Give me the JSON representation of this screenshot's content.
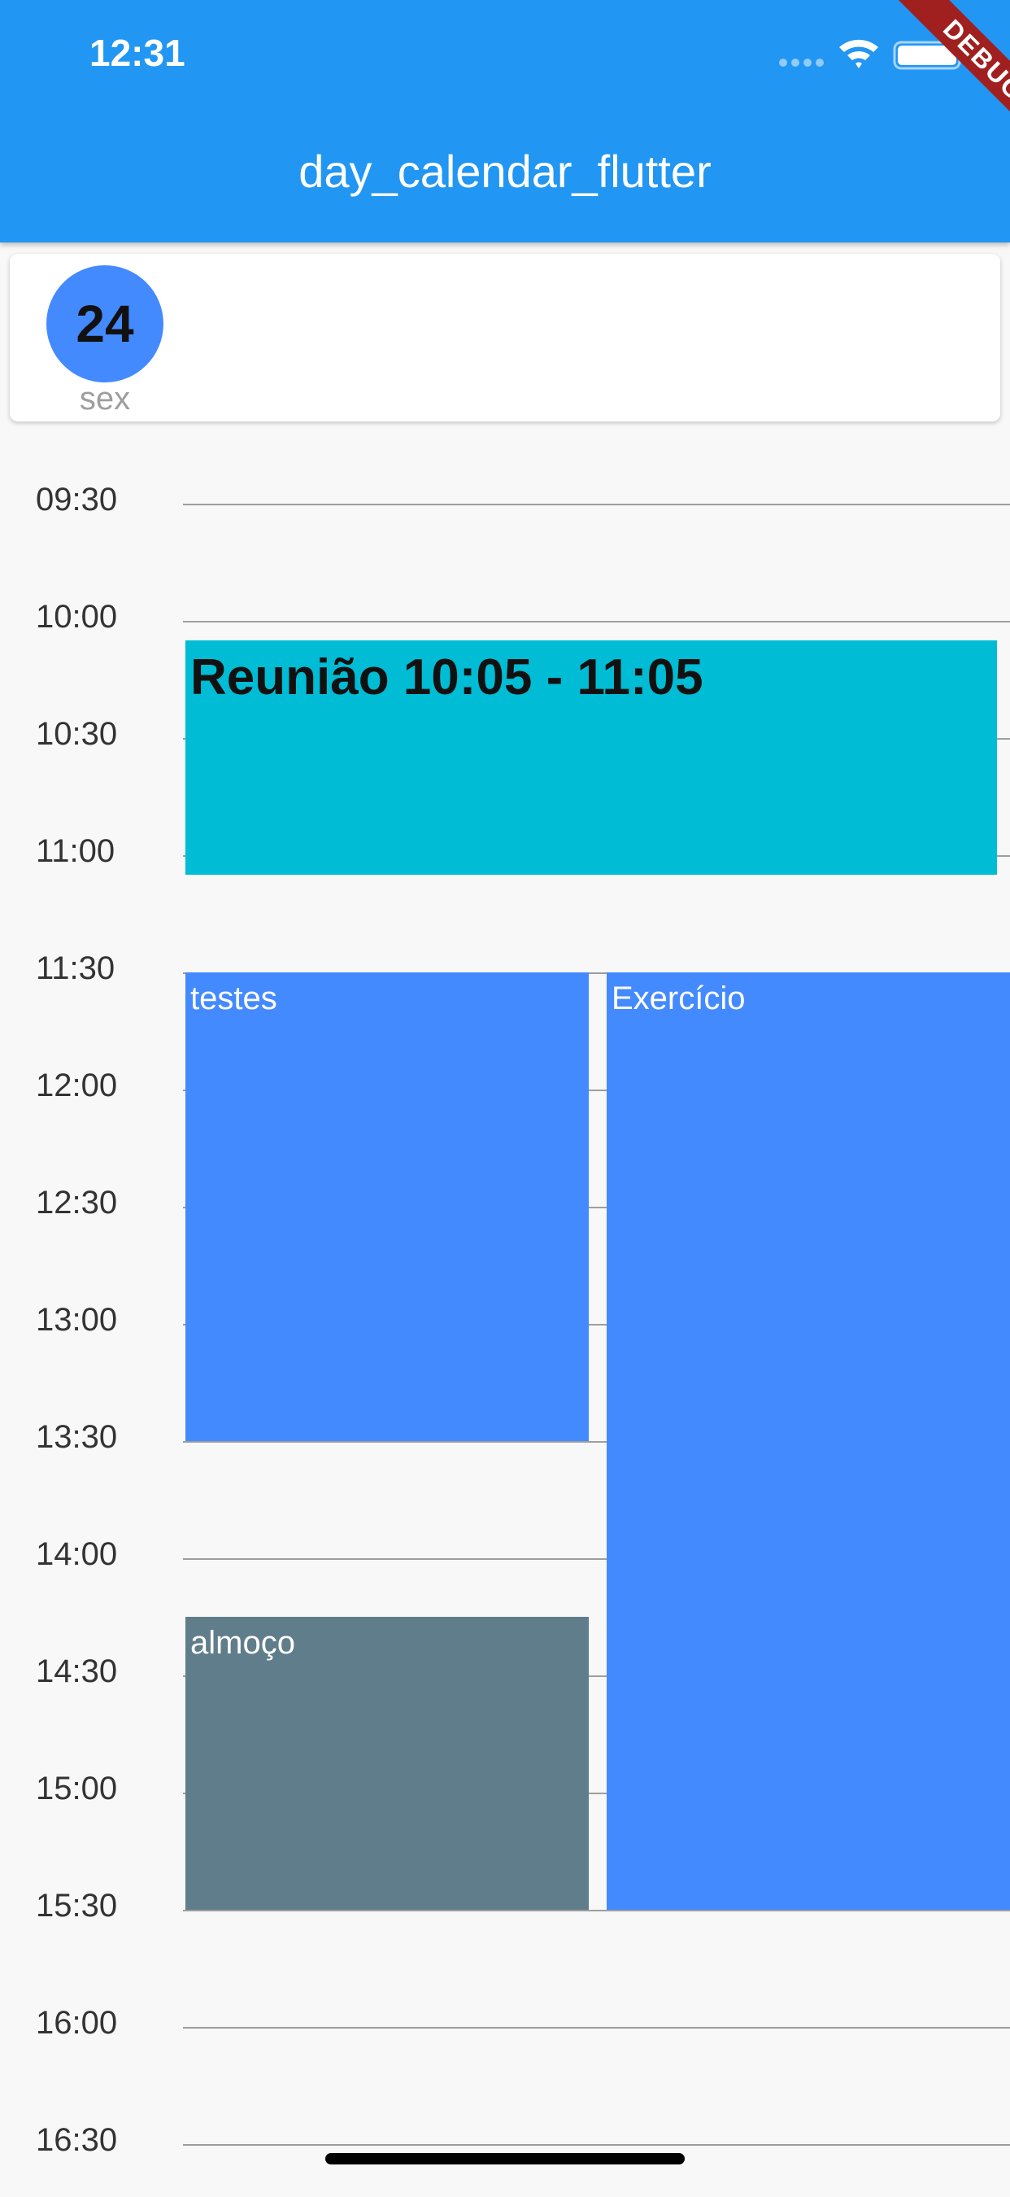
{
  "status_bar": {
    "time": "12:31"
  },
  "app_bar": {
    "title": "day_calendar_flutter",
    "debug_label": "DEBUG",
    "color": "#2196f3"
  },
  "day_header": {
    "day_number": "24",
    "day_name": "sex",
    "accent": "#448aff"
  },
  "timeline": {
    "hours": [
      "09:30",
      "10:00",
      "10:30",
      "11:00",
      "11:30",
      "12:00",
      "12:30",
      "13:00",
      "13:30",
      "14:00",
      "14:30",
      "15:00",
      "15:30",
      "16:00",
      "16:30"
    ]
  },
  "events": [
    {
      "title": "Reunião 10:05 - 11:05",
      "start": "10:05",
      "end": "11:05",
      "color": "#00bcd4",
      "column": 0,
      "span": 2
    },
    {
      "title": "testes",
      "start": "11:30",
      "end": "13:30",
      "color": "#448aff",
      "column": 0,
      "span": 1
    },
    {
      "title": "Exercício",
      "start": "11:30",
      "end": "15:30",
      "color": "#448aff",
      "column": 1,
      "span": 1
    },
    {
      "title": "almoço",
      "start": "14:15",
      "end": "15:30",
      "color": "#607d8b",
      "column": 0,
      "span": 1
    }
  ]
}
